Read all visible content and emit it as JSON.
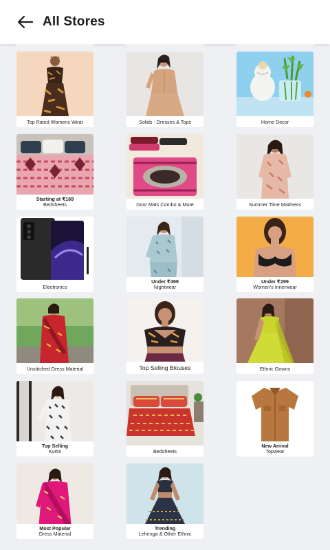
{
  "header": {
    "title": "All Stores",
    "back_icon": "arrow-left-icon"
  },
  "stores": [
    {
      "caption": "Top Rated Womens Wear"
    },
    {
      "caption": "Solids - Dresses & Tops"
    },
    {
      "caption": "Home Decor"
    },
    {
      "line1": "Starting at ₹169",
      "line2": "Bedsheets"
    },
    {
      "caption": "Door Mats Combo & More"
    },
    {
      "caption": "Summer Time Madness"
    },
    {
      "caption": "Electronics"
    },
    {
      "line1": "Under ₹499",
      "line2": "Nightwear"
    },
    {
      "line1": "Under ₹299",
      "line2": "Women's Innerwear"
    },
    {
      "caption": "Unstitched Dress Material"
    },
    {
      "caption": "Top Selling Blouses"
    },
    {
      "caption": "Ethnic Gowns"
    },
    {
      "line1": "Top Selling",
      "line2": "Kurtis"
    },
    {
      "caption": "Bedsheets"
    },
    {
      "line1": "New Arrival",
      "line2": "Topwear"
    },
    {
      "line1": "Most Popular",
      "line2": "Dress Material"
    },
    {
      "line1": "Trending",
      "line2": "Lehenga & Other Ethnic"
    }
  ]
}
